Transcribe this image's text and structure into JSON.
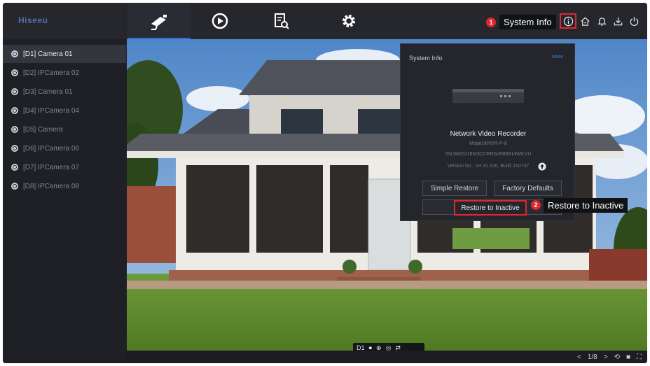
{
  "app": {
    "logo": "Hiseeu"
  },
  "tabs": [
    {
      "name": "live-view",
      "icon": "camera-icon",
      "active": true
    },
    {
      "name": "playback",
      "icon": "playback-icon",
      "active": false
    },
    {
      "name": "search",
      "icon": "file-search-icon",
      "active": false
    },
    {
      "name": "settings",
      "icon": "gear-icon",
      "active": false
    }
  ],
  "callouts": {
    "step1": {
      "number": "1",
      "label": "System Info"
    },
    "step2": {
      "number": "2",
      "label": "Restore to Inactive"
    }
  },
  "toolbar_icons": [
    "info-icon",
    "home-icon",
    "bell-icon",
    "download-icon",
    "power-icon"
  ],
  "cameras": [
    {
      "label": "[D1] Camera 01",
      "active": true
    },
    {
      "label": "[D2] IPCamera 02",
      "active": false
    },
    {
      "label": "[D3] Camera 01",
      "active": false
    },
    {
      "label": "[D4] IPCamera 04",
      "active": false
    },
    {
      "label": "[D5] Camera",
      "active": false
    },
    {
      "label": "[D6] IPCamera 06",
      "active": false
    },
    {
      "label": "[D7] IPCamera 07",
      "active": false
    },
    {
      "label": "[D8] IPCamera 08",
      "active": false
    }
  ],
  "popup": {
    "title": "System Info",
    "more": "More",
    "device_name": "Network Video Recorder",
    "model": "Model:KNVR-P-8",
    "serial": "SN:9820218M3CCRRG4588814WCVU",
    "version": "Version No.: V4.31.100, Build 210707",
    "simple_restore": "Simple Restore",
    "factory_defaults": "Factory Defaults",
    "restore_inactive": "Restore to Inactive"
  },
  "playbar": {
    "channel": "D1"
  },
  "pager": {
    "prev": "<",
    "page": "1/8",
    "next": ">"
  },
  "colors": {
    "accent": "#2f6fd6",
    "callout": "#e0262f",
    "link": "#3f7ce6"
  }
}
